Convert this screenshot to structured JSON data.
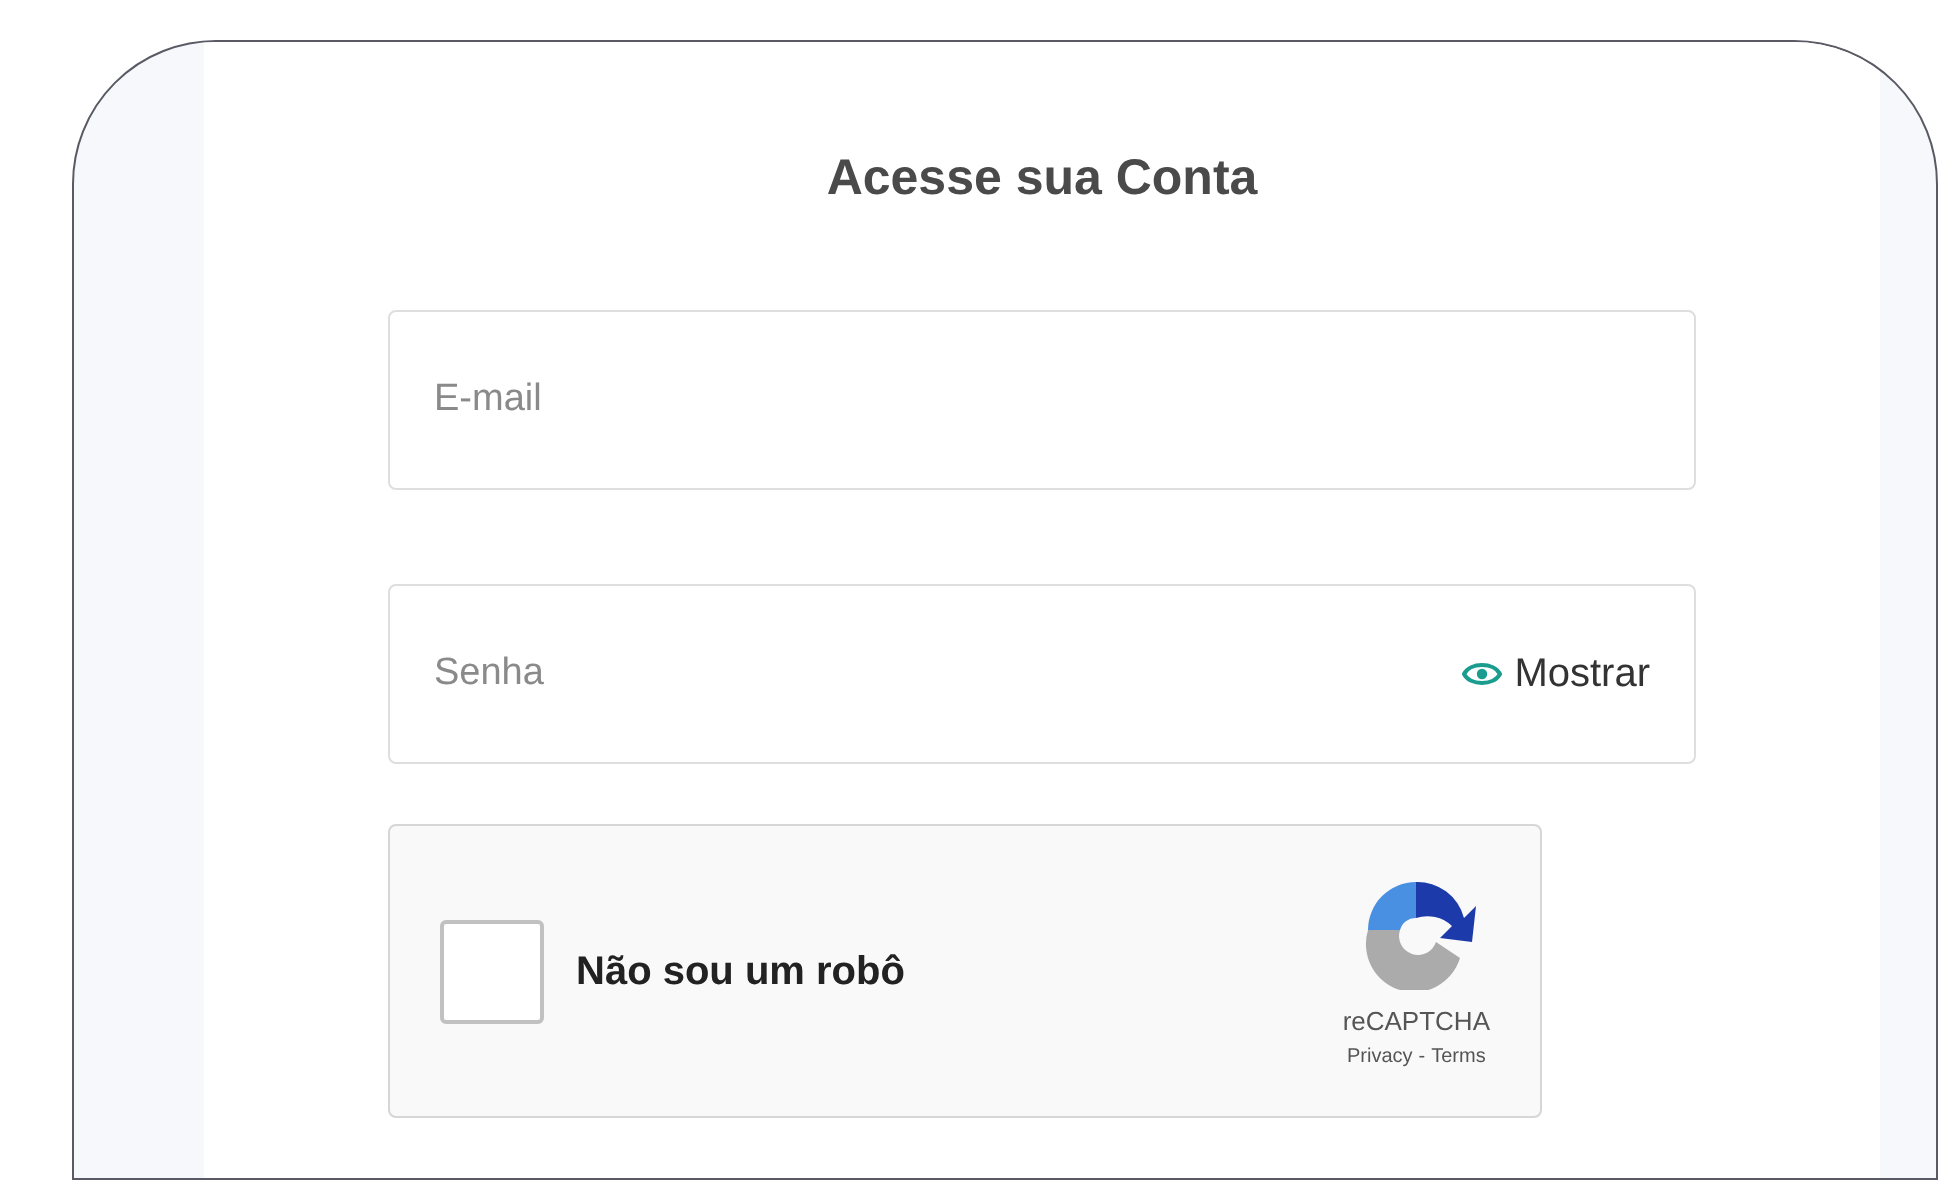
{
  "title": "Acesse sua Conta",
  "email": {
    "placeholder": "E-mail"
  },
  "password": {
    "placeholder": "Senha",
    "toggle_label": "Mostrar"
  },
  "captcha": {
    "label": "Não sou um robô",
    "checked": false,
    "brand": "reCAPTCHA",
    "links": [
      "Privacy",
      "-",
      "Terms"
    ]
  }
}
